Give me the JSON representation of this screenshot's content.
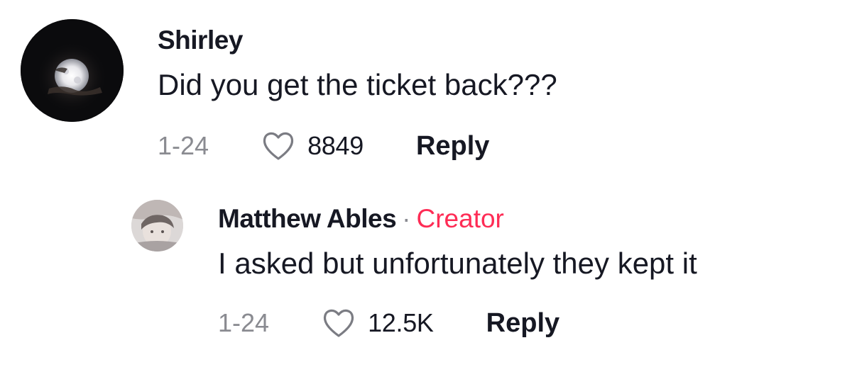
{
  "comments": [
    {
      "username": "Shirley",
      "text": "Did you get the ticket back???",
      "date": "1-24",
      "likes": "8849",
      "reply_label": "Reply",
      "avatar_icon": "moon-night-avatar"
    }
  ],
  "replies": [
    {
      "username": "Matthew Ables",
      "separator": "·",
      "badge": "Creator",
      "text": "I asked but unfortunately they kept it",
      "date": "1-24",
      "likes": "12.5K",
      "reply_label": "Reply",
      "avatar_icon": "person-photo-avatar"
    }
  ],
  "colors": {
    "text": "#161823",
    "muted": "#8a8b91",
    "creator": "#fe2c55",
    "background": "#ffffff"
  },
  "icons": {
    "like": "heart-outline-icon"
  }
}
